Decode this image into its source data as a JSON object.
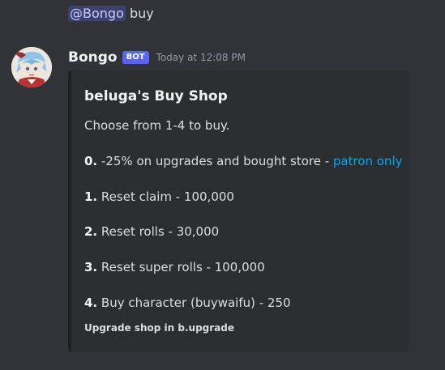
{
  "previous_message": {
    "mention": "@Bongo",
    "text": "buy"
  },
  "message": {
    "author": "Bongo",
    "bot_tag": "BOT",
    "timestamp": "Today at 12:08 PM",
    "avatar": "anime-character-avatar-icon"
  },
  "embed": {
    "title": "beluga's Buy Shop",
    "description": "Choose from 1-4 to buy.",
    "options": [
      {
        "number": "0.",
        "text": "-25% on upgrades and bought store - ",
        "link": "patron only"
      },
      {
        "number": "1.",
        "text": "Reset claim - 100,000"
      },
      {
        "number": "2.",
        "text": "Reset rolls - 30,000"
      },
      {
        "number": "3.",
        "text": "Reset super rolls - 100,000"
      },
      {
        "number": "4.",
        "text": "Buy character (buywaifu) - 250"
      }
    ],
    "footer": "Upgrade shop in b.upgrade"
  },
  "colors": {
    "background": "#313338",
    "embed_background": "#2b2d31",
    "bot_tag": "#5865f2",
    "link": "#00a8fc",
    "mention_background": "#3c4270"
  }
}
